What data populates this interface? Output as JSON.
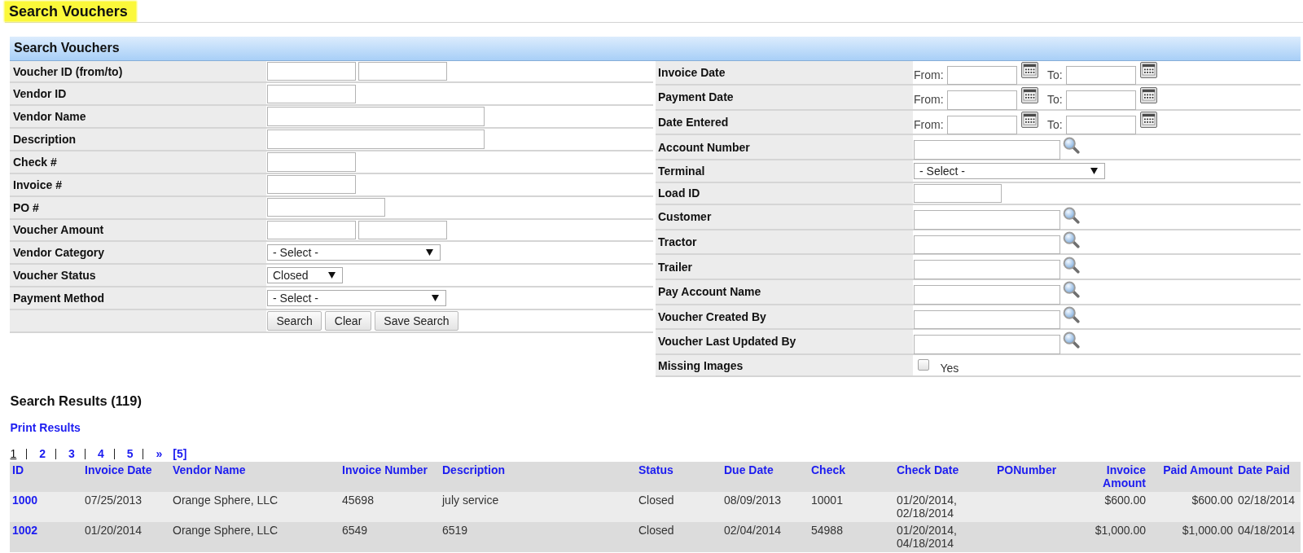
{
  "page_title": "Search Vouchers",
  "search_panel": {
    "title": "Search Vouchers",
    "left_fields": [
      {
        "label": "Voucher ID (from/to)",
        "kind": "pair"
      },
      {
        "label": "Vendor ID",
        "kind": "text"
      },
      {
        "label": "Vendor Name",
        "kind": "text"
      },
      {
        "label": "Description",
        "kind": "text"
      },
      {
        "label": "Check #",
        "kind": "text"
      },
      {
        "label": "Invoice #",
        "kind": "text"
      },
      {
        "label": "PO #",
        "kind": "text"
      },
      {
        "label": "Voucher Amount",
        "kind": "pair"
      },
      {
        "label": "Vendor Category",
        "kind": "select",
        "value": "- Select -"
      },
      {
        "label": "Voucher Status",
        "kind": "select",
        "value": "Closed"
      },
      {
        "label": "Payment Method",
        "kind": "select",
        "value": "- Select -"
      }
    ],
    "buttons": [
      {
        "label": "Search"
      },
      {
        "label": "Clear"
      },
      {
        "label": "Save Search"
      }
    ],
    "right_fields": [
      {
        "label": "Invoice Date",
        "kind": "date_range",
        "from_label": "From:",
        "to_label": "To:"
      },
      {
        "label": "Payment Date",
        "kind": "date_range",
        "from_label": "From:",
        "to_label": "To:"
      },
      {
        "label": "Date Entered",
        "kind": "date_range",
        "from_label": "From:",
        "to_label": "To:"
      },
      {
        "label": "Account Number",
        "kind": "lookup"
      },
      {
        "label": "Terminal",
        "kind": "select",
        "value": "- Select -"
      },
      {
        "label": "Load ID",
        "kind": "text"
      },
      {
        "label": "Customer",
        "kind": "lookup"
      },
      {
        "label": "Tractor",
        "kind": "lookup"
      },
      {
        "label": "Trailer",
        "kind": "lookup"
      },
      {
        "label": "Pay Account Name",
        "kind": "lookup"
      },
      {
        "label": "Voucher Created By",
        "kind": "lookup"
      },
      {
        "label": "Voucher Last Updated By",
        "kind": "lookup"
      },
      {
        "label": "Missing Images",
        "kind": "checkbox",
        "option": "Yes",
        "checked": false
      }
    ]
  },
  "results": {
    "heading": "Search Results (119)",
    "print_link": "Print Results",
    "pagination": [
      {
        "label": "1",
        "kind": "page",
        "selected": true
      },
      {
        "label": "2",
        "kind": "page",
        "selected": false
      },
      {
        "label": "3",
        "kind": "page",
        "selected": false
      },
      {
        "label": "4",
        "kind": "page",
        "selected": false
      },
      {
        "label": "5",
        "kind": "page",
        "selected": false
      },
      {
        "label": "»",
        "kind": "next",
        "selected": false
      },
      {
        "label": "[5]",
        "kind": "last",
        "selected": false
      }
    ],
    "table": {
      "columns": [
        {
          "label": "ID",
          "kind": "link"
        },
        {
          "label": "Invoice Date",
          "kind": "text"
        },
        {
          "label": "Vendor Name",
          "kind": "text"
        },
        {
          "label": "Invoice Number",
          "kind": "text"
        },
        {
          "label": "Description",
          "kind": "text"
        },
        {
          "label": "Status",
          "kind": "text"
        },
        {
          "label": "Due Date",
          "kind": "text"
        },
        {
          "label": "Check",
          "kind": "text"
        },
        {
          "label": "Check Date",
          "kind": "text"
        },
        {
          "label": "PONumber",
          "kind": "text"
        },
        {
          "label": "Invoice Amount",
          "kind": "amount"
        },
        {
          "label": "Paid Amount",
          "kind": "amount"
        },
        {
          "label": "Date Paid",
          "kind": "text"
        }
      ],
      "rows": [
        [
          "1000",
          "07/25/2013",
          "Orange Sphere, LLC",
          "45698",
          "july service",
          "Closed",
          "08/09/2013",
          "10001",
          "01/20/2014, 02/18/2014",
          null,
          "$600.00",
          "$600.00",
          "02/18/2014"
        ],
        [
          "1002",
          "01/20/2014",
          "Orange Sphere, LLC",
          "6549",
          "6519",
          "Closed",
          "02/04/2014",
          "54988",
          "01/20/2014, 04/18/2014",
          null,
          "$1,000.00",
          "$1,000.00",
          "04/18/2014"
        ]
      ]
    }
  }
}
